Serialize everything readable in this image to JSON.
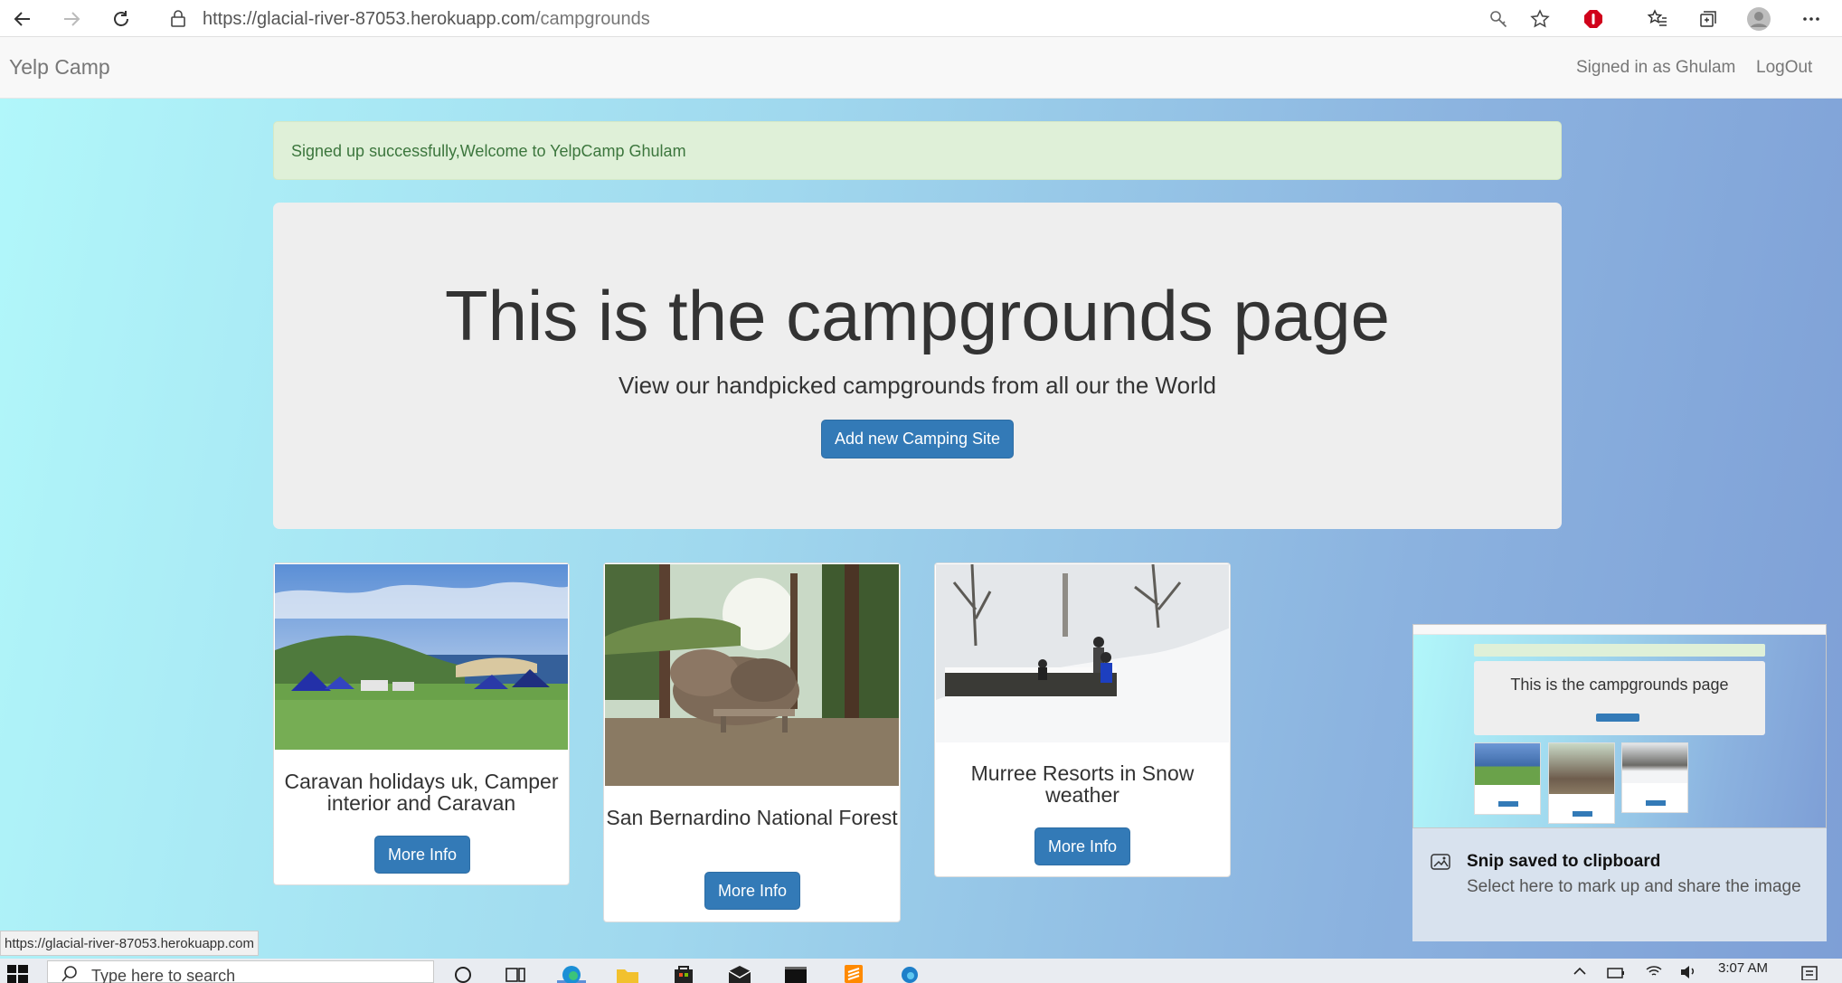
{
  "browser": {
    "url_host": "https://glacial-river-87053.herokuapp.com",
    "url_path": "/campgrounds"
  },
  "navbar": {
    "brand": "Yelp Camp",
    "signed_in": "Signed in as Ghulam",
    "logout": "LogOut"
  },
  "alert": {
    "message": "Signed up successfully,Welcome to YelpCamp Ghulam"
  },
  "jumbotron": {
    "title": "This is the campgrounds page",
    "subtitle": "View our handpicked campgrounds from all our the World",
    "add_button": "Add new Camping Site"
  },
  "campgrounds": [
    {
      "title": "Caravan holidays uk, Camper interior and Caravan",
      "button": "More Info"
    },
    {
      "title": "San Bernardino National Forest",
      "button": "More Info"
    },
    {
      "title": "Murree Resorts in Snow weather",
      "button": "More Info"
    }
  ],
  "snip": {
    "title": "Snip saved to clipboard",
    "message": "Select here to mark up and share the image"
  },
  "status_url": "https://glacial-river-87053.herokuapp.com",
  "taskbar": {
    "search_placeholder": "Type here to search",
    "time": "3:07 AM"
  },
  "colors": {
    "primary": "#337ab7",
    "alert_bg": "#dff0d8",
    "alert_text": "#3c763d",
    "jumbotron_bg": "#eeeeee"
  }
}
